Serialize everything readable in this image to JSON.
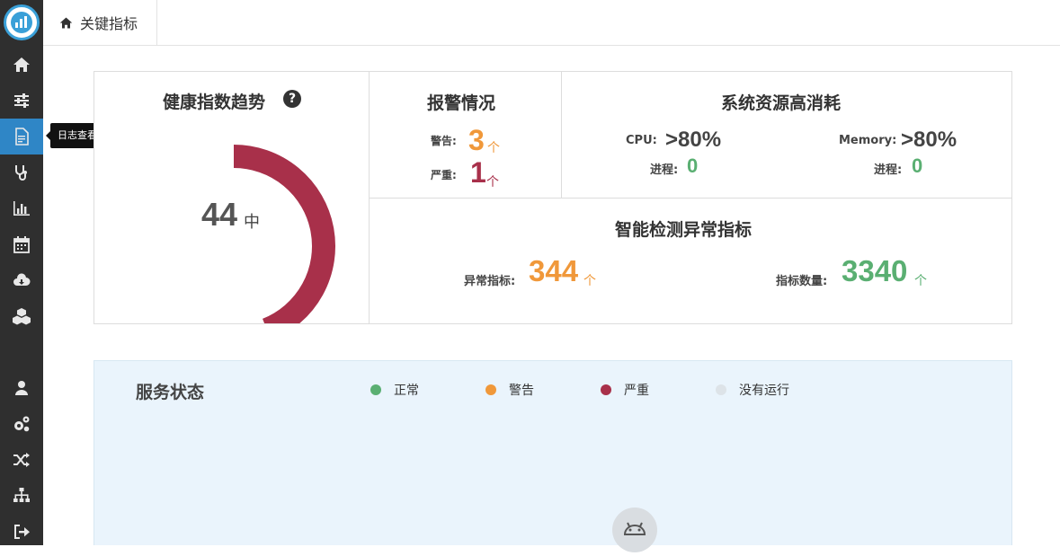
{
  "topbar": {
    "breadcrumb": "关键指标"
  },
  "sidebar": {
    "items": [
      {
        "icon": "home-icon"
      },
      {
        "icon": "sliders-icon"
      },
      {
        "icon": "log-file-icon"
      },
      {
        "icon": "stethoscope-icon"
      },
      {
        "icon": "bar-chart-icon"
      },
      {
        "icon": "calendar-icon"
      },
      {
        "icon": "cloud-download-icon"
      },
      {
        "icon": "cubes-icon"
      },
      {
        "icon": "user-icon"
      },
      {
        "icon": "gears-icon"
      },
      {
        "icon": "shuffle-icon"
      },
      {
        "icon": "sitemap-icon"
      },
      {
        "icon": "sign-out-icon"
      }
    ],
    "tooltip": "日志查看"
  },
  "health": {
    "title": "健康指数趋势",
    "value": "44",
    "level": "中",
    "score_fraction": 0.44,
    "gauge_color": "#a8304a"
  },
  "alerts": {
    "title": "报警情况",
    "warning_label": "警告:",
    "warning_value": "3",
    "warning_unit": "个",
    "severe_label": "严重:",
    "severe_value": "1",
    "severe_unit": "个"
  },
  "resources": {
    "title": "系统资源高消耗",
    "cpu_label": "CPU:",
    "cpu_value": ">80%",
    "cpu_proc_label": "进程:",
    "cpu_proc_value": "0",
    "mem_label": "Memory:",
    "mem_value": ">80%",
    "mem_proc_label": "进程:",
    "mem_proc_value": "0"
  },
  "anomaly": {
    "title": "智能检测异常指标",
    "abnormal_label": "异常指标:",
    "abnormal_value": "344",
    "abnormal_unit": "个",
    "count_label": "指标数量:",
    "count_value": "3340",
    "count_unit": "个"
  },
  "service": {
    "title": "服务状态",
    "legend": [
      {
        "label": "正常",
        "color": "#5aaf72"
      },
      {
        "label": "警告",
        "color": "#f0983a"
      },
      {
        "label": "严重",
        "color": "#a8304a"
      },
      {
        "label": "没有运行",
        "color": "#dde3e8"
      }
    ]
  }
}
